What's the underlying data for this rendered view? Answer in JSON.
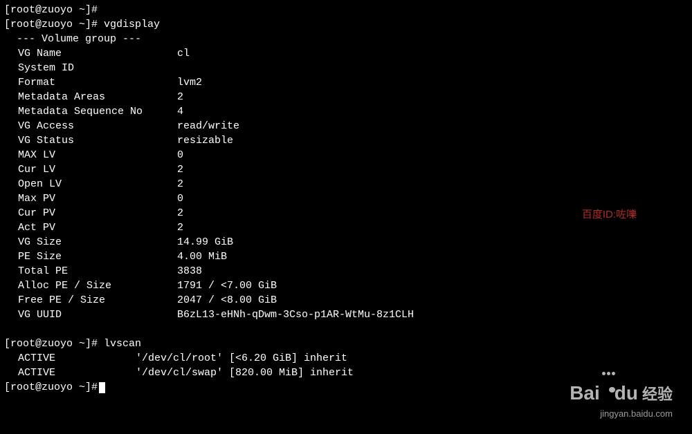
{
  "prompts": {
    "p1": "[root@zuoyo ~]#",
    "p2": "[root@zuoyo ~]# ",
    "p3": "[root@zuoyo ~]# ",
    "p4": "[root@zuoyo ~]#"
  },
  "commands": {
    "vgdisplay": "vgdisplay",
    "lvscan": "lvscan"
  },
  "vg_header": "  --- Volume group ---",
  "vg": {
    "name_label": "VG Name",
    "name_value": "cl",
    "sysid_label": "System ID",
    "sysid_value": "",
    "format_label": "Format",
    "format_value": "lvm2",
    "meta_areas_label": "Metadata Areas",
    "meta_areas_value": "2",
    "meta_seq_label": "Metadata Sequence No",
    "meta_seq_value": "4",
    "access_label": "VG Access",
    "access_value": "read/write",
    "status_label": "VG Status",
    "status_value": "resizable",
    "max_lv_label": "MAX LV",
    "max_lv_value": "0",
    "cur_lv_label": "Cur LV",
    "cur_lv_value": "2",
    "open_lv_label": "Open LV",
    "open_lv_value": "2",
    "max_pv_label": "Max PV",
    "max_pv_value": "0",
    "cur_pv_label": "Cur PV",
    "cur_pv_value": "2",
    "act_pv_label": "Act PV",
    "act_pv_value": "2",
    "vg_size_label": "VG Size",
    "vg_size_value": "14.99 GiB",
    "pe_size_label": "PE Size",
    "pe_size_value": "4.00 MiB",
    "total_pe_label": "Total PE",
    "total_pe_value": "3838",
    "alloc_label": "Alloc PE / Size",
    "alloc_value": "1791 / <7.00 GiB",
    "free_label": "Free  PE / Size",
    "free_value": "2047 / <8.00 GiB",
    "uuid_label": "VG UUID",
    "uuid_value": "B6zL13-eHNh-qDwm-3Cso-p1AR-WtMu-8z1CLH"
  },
  "lv": [
    {
      "status": "ACTIVE",
      "detail": "'/dev/cl/root' [<6.20 GiB] inherit"
    },
    {
      "status": "ACTIVE",
      "detail": "'/dev/cl/swap' [820.00 MiB] inherit"
    }
  ],
  "watermark": {
    "text": "百度ID:咗嚛",
    "logo_main": "Bai",
    "logo_du": "du",
    "logo_cn": "经验",
    "logo_sub": "jingyan.baidu.com"
  }
}
